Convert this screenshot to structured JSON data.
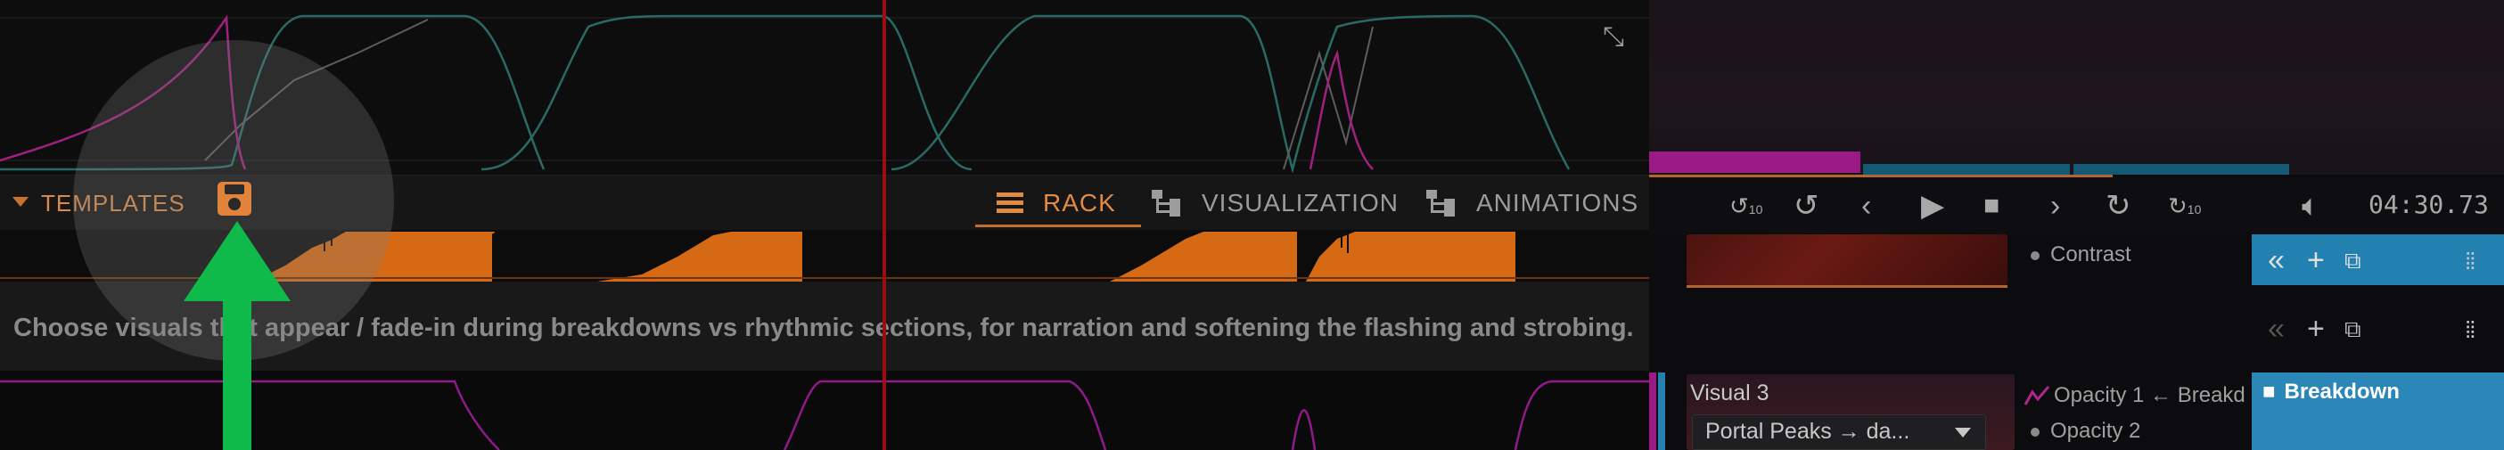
{
  "templates": {
    "label": "TEMPLATES",
    "save_icon": "save-icon"
  },
  "tabs": [
    {
      "label": "RACK",
      "icon": "list-icon",
      "active": true
    },
    {
      "label": "VISUALIZATION",
      "icon": "tree-icon",
      "active": false
    },
    {
      "label": "ANIMATIONS",
      "icon": "tree-icon",
      "active": false
    }
  ],
  "description": "Choose visuals that appear / fade-in during breakdowns vs rhythmic sections, for narration and softening the flashing and strobing.",
  "transport": {
    "time": "04:30.73",
    "buttons": [
      "rewind-10-icon",
      "rewind-icon",
      "prev-icon",
      "play-icon",
      "stop-icon",
      "next-icon",
      "forward-icon",
      "forward-10-icon",
      "volume-icon"
    ],
    "skip_back_label": "10",
    "skip_forward_label": "10"
  },
  "layers": {
    "contrast_label": "Contrast",
    "visual3": {
      "title": "Visual 3",
      "source": "Portal Peaks → da...",
      "opacity1": "Opacity 1 ← Breakd",
      "opacity2": "Opacity 2"
    },
    "breakdown_label": "Breakdown"
  },
  "colors": {
    "accent": "#e08a44",
    "playhead": "#9b0d10",
    "breakdown_blue": "#2a87b8",
    "lfo_magenta": "#9a1a86"
  }
}
